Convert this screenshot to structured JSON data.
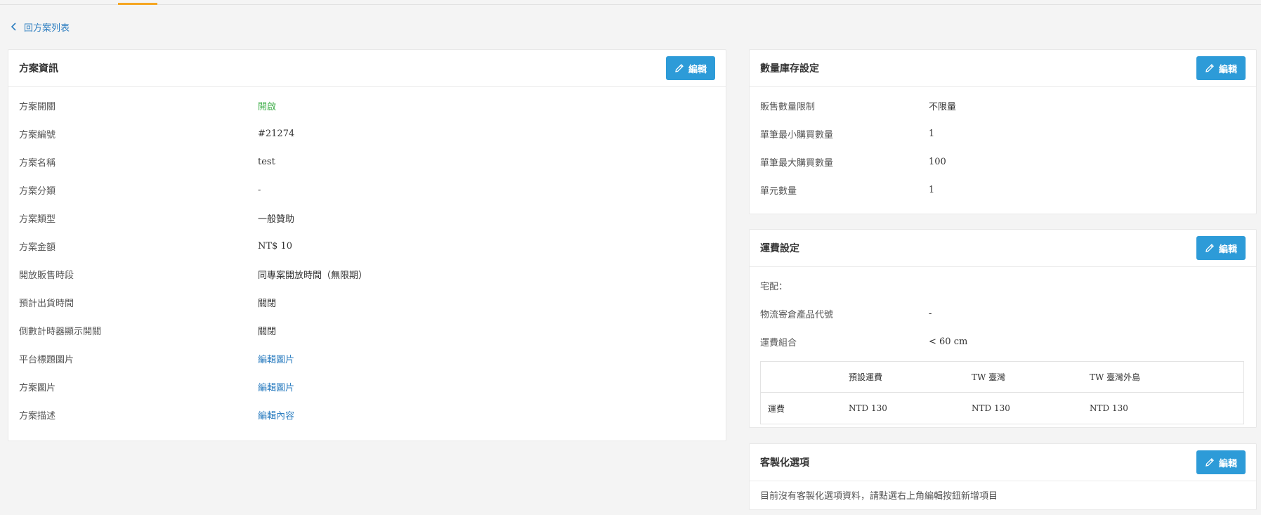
{
  "back_link": {
    "label": "回方案列表",
    "icon": "chevron-left-icon"
  },
  "edit_label": "編輯",
  "plan_info": {
    "title": "方案資訊",
    "rows": [
      {
        "label": "方案開關",
        "value": "開啟"
      },
      {
        "label": "方案編號",
        "value": "#21274"
      },
      {
        "label": "方案名稱",
        "value": "test"
      },
      {
        "label": "方案分類",
        "value": "-"
      },
      {
        "label": "方案類型",
        "value": "一般贊助"
      },
      {
        "label": "方案金額",
        "value": "NT$ 10"
      },
      {
        "label": "開放販售時段",
        "value": "同專案開放時間（無限期）"
      },
      {
        "label": "預計出貨時間",
        "value": "關閉"
      },
      {
        "label": "倒數計時器顯示開關",
        "value": "關閉"
      },
      {
        "label": "平台標題圖片",
        "value": "編輯圖片"
      },
      {
        "label": "方案圖片",
        "value": "編輯圖片"
      },
      {
        "label": "方案描述",
        "value": "編輯內容"
      }
    ]
  },
  "inventory": {
    "title": "數量庫存設定",
    "rows": [
      {
        "label": "販售數量限制",
        "value": "不限量"
      },
      {
        "label": "單筆最小購買數量",
        "value": "1"
      },
      {
        "label": "單筆最大購買數量",
        "value": "100"
      },
      {
        "label": "單元數量",
        "value": "1"
      }
    ]
  },
  "shipping": {
    "title": "運費設定",
    "rows": [
      {
        "label": "宅配：",
        "value": ""
      },
      {
        "label": "物流寄倉產品代號",
        "value": "-"
      },
      {
        "label": "運費組合",
        "value": "< 60 cm"
      }
    ],
    "table": {
      "headers": [
        "",
        "預設運費",
        "TW 臺灣",
        "TW 臺灣外島"
      ],
      "rows": [
        [
          "運費",
          "NTD 130",
          "NTD 130",
          "NTD 130"
        ]
      ]
    }
  },
  "custom_options": {
    "title": "客製化選項",
    "empty_message": "目前沒有客製化選項資料，請點選右上角編輯按鈕新增項目"
  },
  "colors": {
    "accent": "#2d9bd8",
    "link": "#2f7fc1",
    "on": "#3fae49",
    "tab_indicator": "#f5a623"
  }
}
